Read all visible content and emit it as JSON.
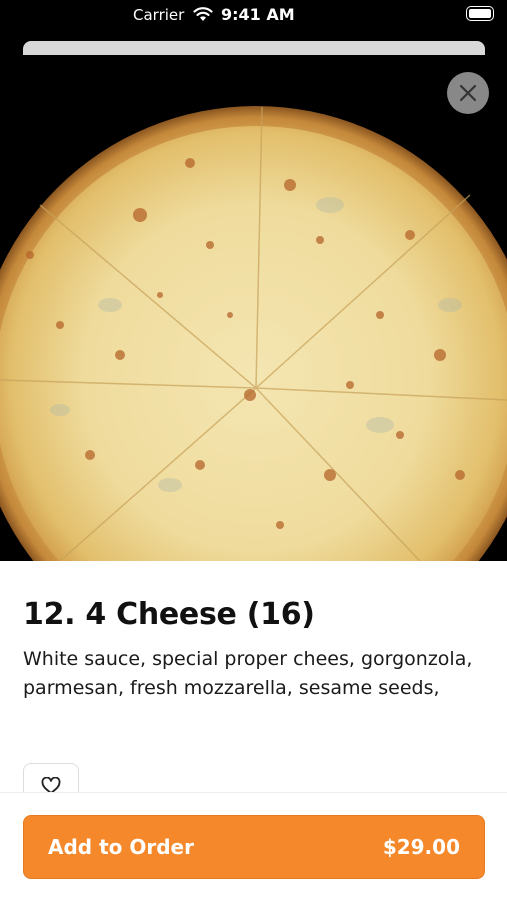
{
  "status_bar": {
    "carrier": "Carrier",
    "time": "9:41 AM"
  },
  "item": {
    "title": "12. 4 Cheese (16)",
    "description": "White sauce, special proper chees, gorgonzola, parmesan, fresh mozzarella, sesame seeds,"
  },
  "order_button": {
    "label": "Add to Order",
    "price": "$29.00"
  },
  "colors": {
    "accent": "#f5882a",
    "hero_background": "#000000",
    "sheet_handle": "#d8d8d8"
  },
  "icons": {
    "close": "close-icon",
    "favorite": "heart-icon",
    "wifi": "wifi-icon",
    "battery": "battery-icon"
  }
}
